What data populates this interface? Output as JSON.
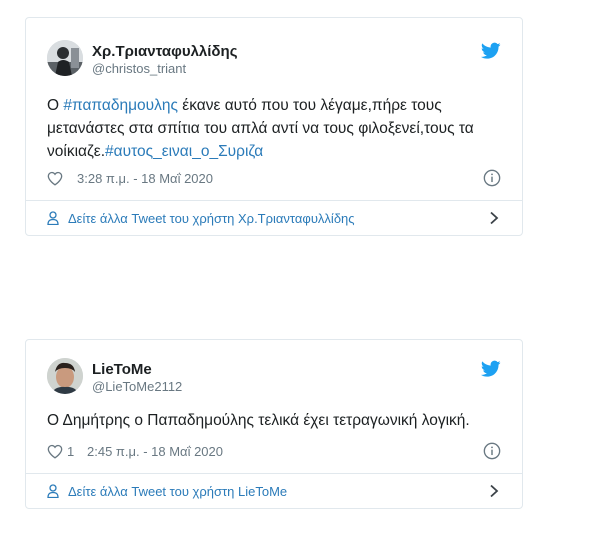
{
  "tweets": [
    {
      "author_name": "Χρ.Τριανταφυλλίδης",
      "handle": "@christos_triant",
      "text_parts": [
        {
          "t": "Ο ",
          "hashtag": false
        },
        {
          "t": "#παπαδημουλης",
          "hashtag": true
        },
        {
          "t": " έκανε αυτό που του λέγαμε,πήρε τους μετανάστες στα σπίτια του απλά αντί να τους φιλοξενεί,τους τα νοίκιαζε.",
          "hashtag": false
        },
        {
          "t": "#αυτος_ειναι_ο_Συριζα",
          "hashtag": true
        }
      ],
      "like_count": "",
      "timestamp": "3:28 π.μ. - 18 Μαΐ 2020",
      "more_link": "Δείτε άλλα Tweet του χρήστη Χρ.Τριανταφυλλίδης"
    },
    {
      "author_name": "LieToMe",
      "handle": "@LieToMe2112",
      "text": "Ο Δημήτρης ο Παπαδημούλης τελικά έχει τετραγωνική λογική.",
      "like_count": "1",
      "timestamp": "2:45 π.μ. - 18 Μαΐ 2020",
      "more_link": "Δείτε άλλα Tweet του χρήστη LieToMe"
    }
  ],
  "colors": {
    "link": "#2b7bb9",
    "twitter_blue": "#1da1f2",
    "meta_gray": "#697882",
    "border": "#e1e8ed"
  },
  "icons": [
    "twitter-bird-icon",
    "heart-icon",
    "info-icon",
    "user-icon",
    "chevron-right-icon"
  ]
}
